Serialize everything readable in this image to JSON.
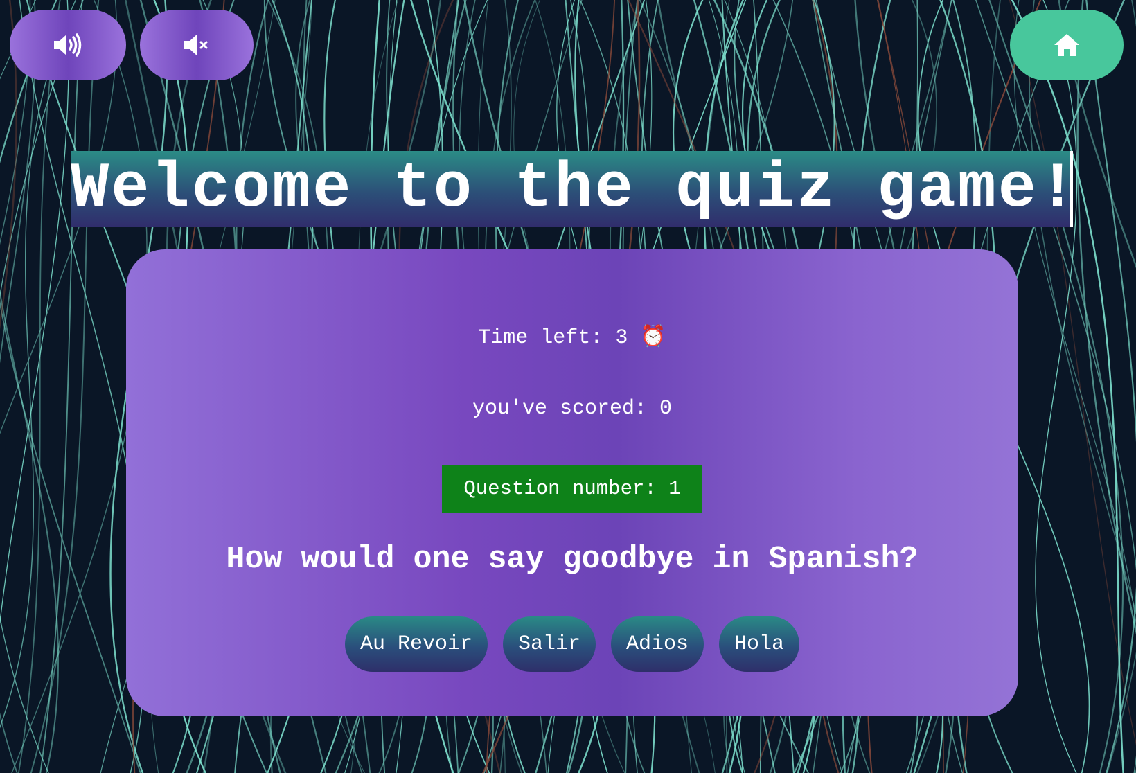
{
  "colors": {
    "background": "#0a1626",
    "line_teal": "#7fe3d0",
    "line_rust": "#8a4a3a",
    "purple_button": "#7a4fc4",
    "home_button": "#48c79c",
    "card": "#7848bf",
    "question_number_bg": "#0e8219",
    "answer_button": "#2a4f7c"
  },
  "toolbar": {
    "sound_on_icon": "volume-up-icon",
    "sound_off_icon": "volume-mute-icon",
    "home_icon": "home-icon"
  },
  "title": "Welcome to the quiz game!",
  "quiz": {
    "time_label": "Time left: ",
    "time_value": "3",
    "time_icon": "⏰",
    "score_label": "you've scored: ",
    "score_value": "0",
    "question_number_label": "Question number: ",
    "question_number_value": "1",
    "question": "How would one say goodbye in Spanish?",
    "answers": [
      "Au Revoir",
      "Salir",
      "Adios",
      "Hola"
    ]
  }
}
